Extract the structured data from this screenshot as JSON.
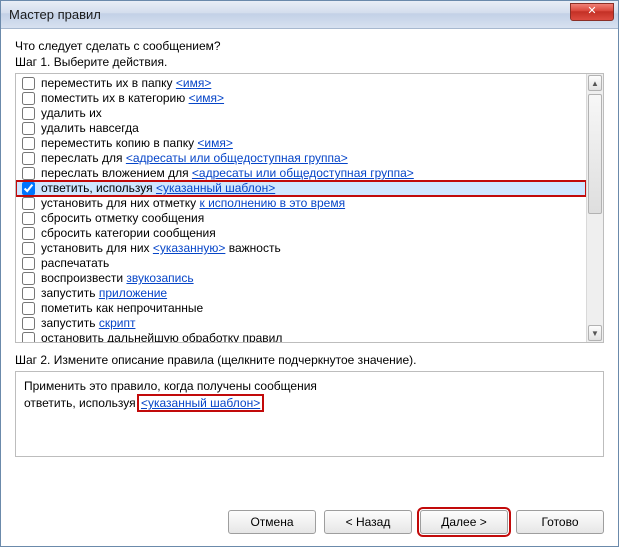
{
  "window": {
    "title": "Мастер правил"
  },
  "prompt": "Что следует сделать с сообщением?",
  "step1": "Шаг 1. Выберите действия.",
  "step2": "Шаг 2. Измените описание правила (щелкните подчеркнутое значение).",
  "actions": [
    {
      "checked": false,
      "pre": "переместить их в папку ",
      "link": "<имя>",
      "post": ""
    },
    {
      "checked": false,
      "pre": "поместить их в категорию ",
      "link": "<имя>",
      "post": ""
    },
    {
      "checked": false,
      "pre": "удалить их",
      "link": "",
      "post": ""
    },
    {
      "checked": false,
      "pre": "удалить навсегда",
      "link": "",
      "post": ""
    },
    {
      "checked": false,
      "pre": "переместить копию в папку ",
      "link": "<имя>",
      "post": ""
    },
    {
      "checked": false,
      "pre": "переслать для ",
      "link": "<адресаты или общедоступная группа>",
      "post": ""
    },
    {
      "checked": false,
      "pre": "переслать вложением для ",
      "link": "<адресаты или общедоступная группа>",
      "post": ""
    },
    {
      "checked": true,
      "pre": "ответить, используя ",
      "link": "<указанный шаблон>",
      "post": "",
      "selected": true,
      "highlighted": true
    },
    {
      "checked": false,
      "pre": "установить для них отметку ",
      "link": "к исполнению в это время",
      "post": ""
    },
    {
      "checked": false,
      "pre": "сбросить отметку сообщения",
      "link": "",
      "post": ""
    },
    {
      "checked": false,
      "pre": "сбросить категории сообщения",
      "link": "",
      "post": ""
    },
    {
      "checked": false,
      "pre": "установить для них ",
      "link": "<указанную>",
      "post": " важность"
    },
    {
      "checked": false,
      "pre": "распечатать",
      "link": "",
      "post": ""
    },
    {
      "checked": false,
      "pre": "воспроизвести ",
      "link": "звукозапись",
      "post": ""
    },
    {
      "checked": false,
      "pre": "запустить ",
      "link": "приложение",
      "post": ""
    },
    {
      "checked": false,
      "pre": "пометить как непрочитанные",
      "link": "",
      "post": ""
    },
    {
      "checked": false,
      "pre": "запустить ",
      "link": "скрипт",
      "post": ""
    },
    {
      "checked": false,
      "pre": "остановить дальнейшую обработку правил",
      "link": "",
      "post": ""
    }
  ],
  "description": {
    "line1": "Применить это правило, когда получены сообщения",
    "line2_pre": "ответить, используя ",
    "line2_link": "<указанный шаблон>"
  },
  "buttons": {
    "cancel": "Отмена",
    "back": "< Назад",
    "next": "Далее >",
    "finish": "Готово"
  }
}
